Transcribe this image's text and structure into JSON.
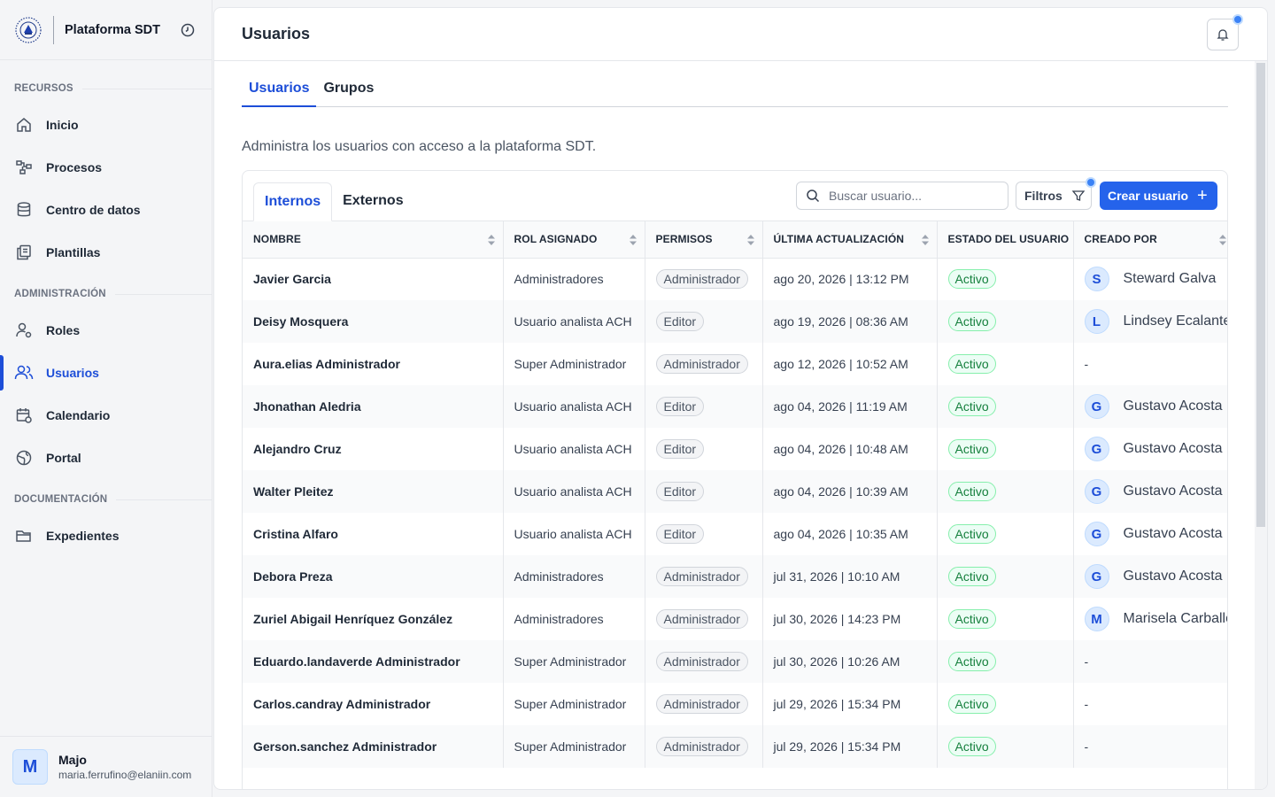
{
  "sidebar": {
    "brand": "Plataforma SDT",
    "sections": [
      {
        "label": "RECURSOS",
        "items": [
          {
            "label": "Inicio",
            "icon": "home-icon"
          },
          {
            "label": "Procesos",
            "icon": "process-icon"
          },
          {
            "label": "Centro de datos",
            "icon": "database-icon"
          },
          {
            "label": "Plantillas",
            "icon": "templates-icon"
          }
        ]
      },
      {
        "label": "ADMINISTRACIÓN",
        "items": [
          {
            "label": "Roles",
            "icon": "user-gear-icon"
          },
          {
            "label": "Usuarios",
            "icon": "users-icon",
            "active": true
          },
          {
            "label": "Calendario",
            "icon": "calendar-icon"
          },
          {
            "label": "Portal",
            "icon": "globe-icon"
          }
        ]
      },
      {
        "label": "DOCUMENTACIÓN",
        "items": [
          {
            "label": "Expedientes",
            "icon": "folder-icon"
          }
        ]
      }
    ],
    "user": {
      "initial": "M",
      "name": "Majo",
      "email": "maria.ferrufino@elaniin.com"
    }
  },
  "header": {
    "title": "Usuarios"
  },
  "tabs": [
    "Usuarios",
    "Grupos"
  ],
  "description": "Administra los usuarios con acceso a la plataforma SDT.",
  "subtabs": [
    "Internos",
    "Externos"
  ],
  "search": {
    "placeholder": "Buscar usuario..."
  },
  "filters_label": "Filtros",
  "create_label": "Crear usuario",
  "colors": {
    "accent": "#2563eb",
    "active_status": "#15803d"
  },
  "table": {
    "columns": [
      "NOMBRE",
      "ROL ASIGNADO",
      "PERMISOS",
      "ÚLTIMA ACTUALIZACIÓN",
      "ESTADO DEL USUARIO",
      "CREADO POR"
    ],
    "rows": [
      {
        "name": "Javier Garcia",
        "role": "Administradores",
        "perm": "Administrador",
        "updated": "ago 20, 2026 | 13:12 PM",
        "status": "Activo",
        "creator_initial": "S",
        "creator": "Steward Galva"
      },
      {
        "name": "Deisy Mosquera",
        "role": "Usuario analista ACH",
        "perm": "Editor",
        "updated": "ago 19, 2026 | 08:36 AM",
        "status": "Activo",
        "creator_initial": "L",
        "creator": "Lindsey Ecalante"
      },
      {
        "name": "Aura.elias Administrador",
        "role": "Super Administrador",
        "perm": "Administrador",
        "updated": "ago 12, 2026 | 10:52 AM",
        "status": "Activo",
        "creator_initial": "",
        "creator": "-"
      },
      {
        "name": "Jhonathan Aledria",
        "role": "Usuario analista ACH",
        "perm": "Editor",
        "updated": "ago 04, 2026 | 11:19 AM",
        "status": "Activo",
        "creator_initial": "G",
        "creator": "Gustavo Acosta"
      },
      {
        "name": "Alejandro Cruz",
        "role": "Usuario analista ACH",
        "perm": "Editor",
        "updated": "ago 04, 2026 | 10:48 AM",
        "status": "Activo",
        "creator_initial": "G",
        "creator": "Gustavo Acosta"
      },
      {
        "name": "Walter Pleitez",
        "role": "Usuario analista ACH",
        "perm": "Editor",
        "updated": "ago 04, 2026 | 10:39 AM",
        "status": "Activo",
        "creator_initial": "G",
        "creator": "Gustavo Acosta"
      },
      {
        "name": "Cristina Alfaro",
        "role": "Usuario analista ACH",
        "perm": "Editor",
        "updated": "ago 04, 2026 | 10:35 AM",
        "status": "Activo",
        "creator_initial": "G",
        "creator": "Gustavo Acosta"
      },
      {
        "name": "Debora Preza",
        "role": "Administradores",
        "perm": "Administrador",
        "updated": "jul 31, 2026 | 10:10 AM",
        "status": "Activo",
        "creator_initial": "G",
        "creator": "Gustavo Acosta"
      },
      {
        "name": "Zuriel Abigail Henríquez González",
        "role": "Administradores",
        "perm": "Administrador",
        "updated": "jul 30, 2026 | 14:23 PM",
        "status": "Activo",
        "creator_initial": "M",
        "creator": "Marisela Carballo"
      },
      {
        "name": "Eduardo.landaverde Administrador",
        "role": "Super Administrador",
        "perm": "Administrador",
        "updated": "jul 30, 2026 | 10:26 AM",
        "status": "Activo",
        "creator_initial": "",
        "creator": "-"
      },
      {
        "name": "Carlos.candray Administrador",
        "role": "Super Administrador",
        "perm": "Administrador",
        "updated": "jul 29, 2026 | 15:34 PM",
        "status": "Activo",
        "creator_initial": "",
        "creator": "-"
      },
      {
        "name": "Gerson.sanchez Administrador",
        "role": "Super Administrador",
        "perm": "Administrador",
        "updated": "jul 29, 2026 | 15:34 PM",
        "status": "Activo",
        "creator_initial": "",
        "creator": "-"
      }
    ]
  }
}
